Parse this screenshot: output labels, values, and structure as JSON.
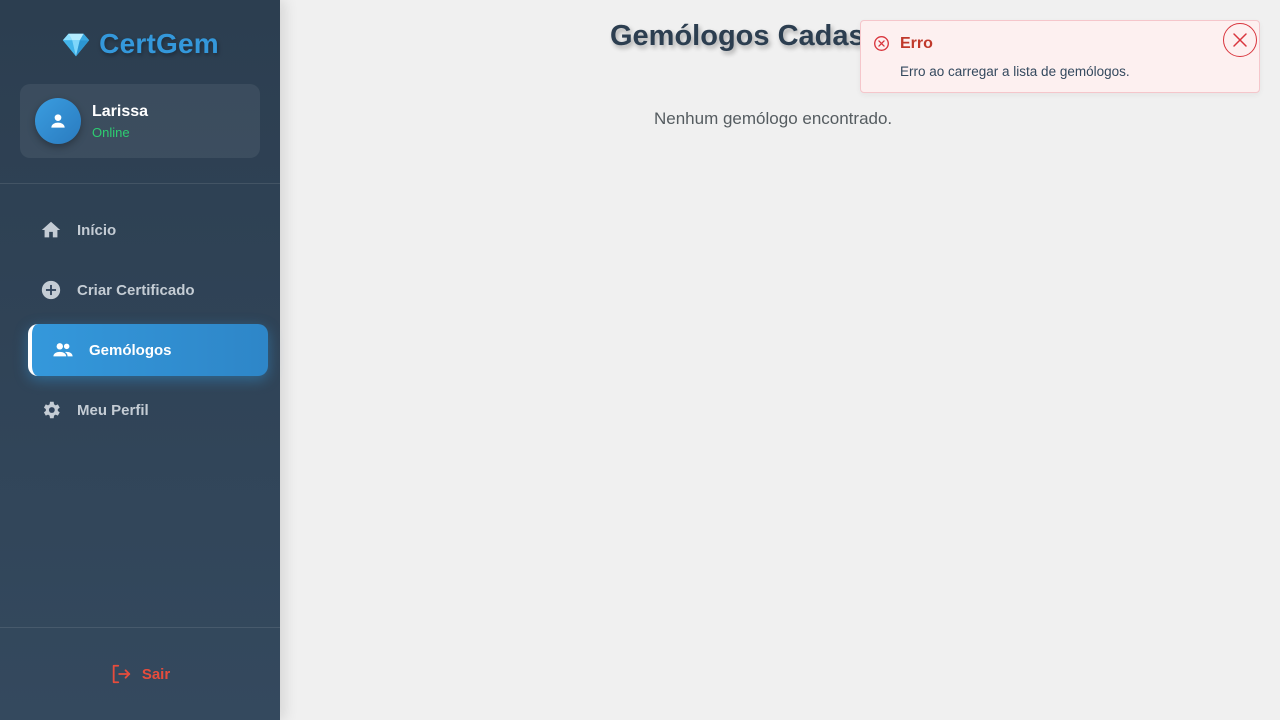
{
  "sidebar": {
    "brand": {
      "name": "CertGem",
      "icon": "gem-icon",
      "color": "#3498db"
    },
    "user": {
      "name": "Larissa",
      "status": "Online",
      "avatar_icon": "user-icon"
    },
    "nav": [
      {
        "label": "Início",
        "icon": "home-icon",
        "active": false
      },
      {
        "label": "Criar Certificado",
        "icon": "add-circle-icon",
        "active": false
      },
      {
        "label": "Gemólogos",
        "icon": "people-icon",
        "active": true
      },
      {
        "label": "Meu Perfil",
        "icon": "gear-icon",
        "active": false
      }
    ],
    "logout": {
      "label": "Sair",
      "icon": "logout-icon",
      "color": "#e74c3c"
    }
  },
  "main": {
    "title": "Gemólogos Cadas",
    "empty_message": "Nenhum gemólogo encontrado."
  },
  "toast": {
    "type": "error",
    "title": "Erro",
    "message": "Erro ao carregar a lista de gemólogos.",
    "icon": "error-circle-icon",
    "close_icon": "close-icon",
    "color": "#d9363e"
  }
}
